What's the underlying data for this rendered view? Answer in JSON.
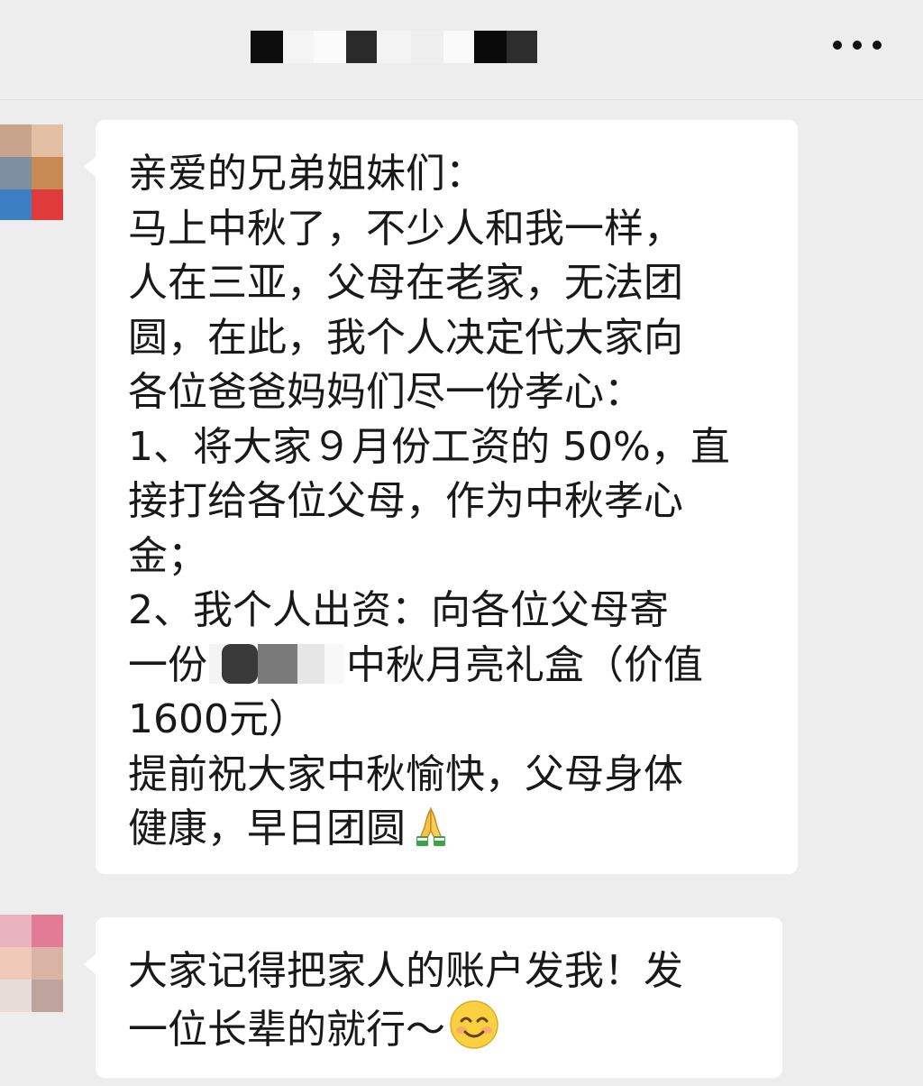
{
  "header": {
    "title_redacted": true,
    "more_icon": "more-dots-icon"
  },
  "messages": [
    {
      "sender_avatar_redacted": true,
      "lines": {
        "l1": "亲爱的兄弟姐妹们：",
        "l2": "马上中秋了，不少人和我一样，",
        "l3": "人在三亚，父母在老家，无法团",
        "l4": "圆，在此，我个人决定代大家向",
        "l5": "各位爸爸妈妈们尽一份孝心：",
        "l6": "1、将大家９月份工资的 50%，直",
        "l7": "接打给各位父母，作为中秋孝心",
        "l8": "金；",
        "l9": "2、我个人出资：向各位父母寄",
        "l10a": "一份",
        "l10b": "中秋月亮礼盒（价值",
        "l11": "1600元）",
        "l12": "提前祝大家中秋愉快，父母身体",
        "l13": "健康，早日团圆"
      },
      "trailing_emoji": "folded-hands-emoji"
    },
    {
      "sender_avatar_redacted": true,
      "lines": {
        "l1": "大家记得把家人的账户发我！发",
        "l2": "一位长辈的就行～"
      },
      "trailing_emoji": "smiling-face-emoji"
    }
  ],
  "colors": {
    "background": "#ededed",
    "bubble": "#ffffff",
    "text": "#191919"
  }
}
